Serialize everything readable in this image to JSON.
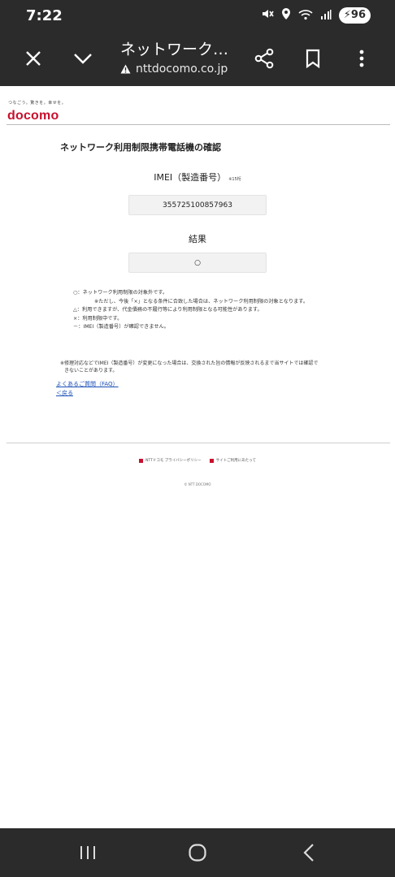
{
  "status_bar": {
    "time": "7:22",
    "battery": "96",
    "icons": [
      "mute-icon",
      "location-icon",
      "wifi-icon",
      "signal-icon"
    ]
  },
  "toolbar": {
    "title": "ネットワーク…",
    "url": "nttdocomo.co.jp",
    "icons": [
      "close-icon",
      "chevron-down-icon",
      "warning-icon",
      "share-icon",
      "bookmark-icon",
      "more-vert-icon"
    ]
  },
  "brand": {
    "tagline": "つなごう。驚きを。幸せを。",
    "logo": "docomo",
    "color": "#c8102e"
  },
  "main": {
    "title": "ネットワーク利用制限携帯電話機の確認",
    "imei_label": "IMEI（製造番号）",
    "imei_note": "※15桁",
    "imei_value": "355725100857963",
    "result_label": "結果",
    "result_value": "○"
  },
  "legend": [
    {
      "symbol": "○",
      "text": "ネットワーク利用制限の対象外です。"
    },
    {
      "symbol": "",
      "text": "※ただし、今後「×」となる条件に合致した場合は、ネットワーク利用制限の対象となります。"
    },
    {
      "symbol": "△",
      "text": "利用できますが、代金債務の不履行等により利用制限となる可能性があります。"
    },
    {
      "symbol": "×",
      "text": "利用制限中です。"
    },
    {
      "symbol": "－",
      "text": "IMEI（製造番号）が確認できません。"
    }
  ],
  "note": {
    "line1": "※修理対応などでIMEI（製造番号）が変更になった場合は、交換された旨の情報が反映されるまで当サイトでは確認で",
    "line2": "きないことがあります。"
  },
  "links": {
    "faq": "よくあるご質問（FAQ）",
    "back": "＜戻る"
  },
  "footer": {
    "privacy": "NTTドコモ プライバシーポリシー",
    "site_usage": "サイトご利用にあたって",
    "copyright": "© NTT DOCOMO"
  },
  "navbar": {
    "icons": [
      "recents-icon",
      "home-icon",
      "back-icon"
    ]
  }
}
